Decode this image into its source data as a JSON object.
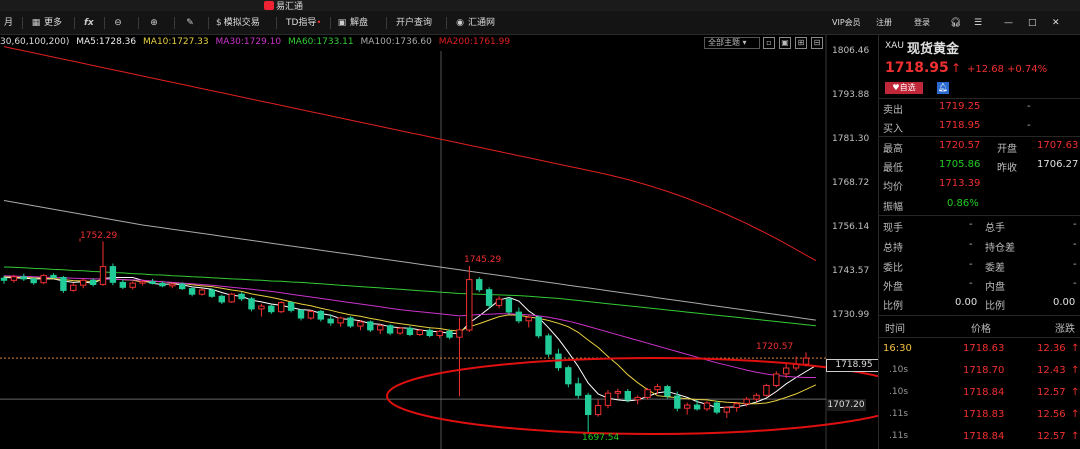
{
  "app": {
    "title": "易汇通"
  },
  "toolbar": {
    "items": [
      {
        "label": "月",
        "icon": ""
      },
      {
        "label": "更多",
        "icon": "grid-icon"
      },
      {
        "label": "",
        "icon": "fx-icon"
      },
      {
        "label": "",
        "icon": "zoom-out-icon"
      },
      {
        "label": "",
        "icon": "zoom-in-icon"
      },
      {
        "label": "",
        "icon": "pen-icon"
      },
      {
        "label": "模拟交易",
        "icon": "dollar-icon"
      },
      {
        "label": "TD指导",
        "icon": "td-icon"
      },
      {
        "label": "解盘",
        "icon": "chat-icon"
      },
      {
        "label": "开户查询",
        "icon": ""
      },
      {
        "label": "汇通网",
        "icon": "globe-icon"
      }
    ],
    "right": {
      "vip": "VIP会员",
      "register": "注册",
      "login": "登录"
    }
  },
  "legend": {
    "params": "30,60,100,200)",
    "ma5": "MA5:1728.36",
    "ma10": "MA10:1727.33",
    "ma30": "MA30:1729.10",
    "ma60": "MA60:1733.11",
    "ma100": "MA100:1736.60",
    "ma200": "MA200:1761.99",
    "theme": "全部主题"
  },
  "colors": {
    "ma5": "#ffffff",
    "ma10": "#e8d040",
    "ma30": "#cc33cc",
    "ma60": "#33cc33",
    "ma100": "#aaaaaa",
    "ma200": "#e02020",
    "up": "#f03030",
    "down": "#22cc99"
  },
  "axis": {
    "ticks": [
      "1806.46",
      "1793.88",
      "1781.30",
      "1768.72",
      "1756.14",
      "1743.57",
      "1730.99",
      "1718.95",
      "1707.20"
    ]
  },
  "annotations": {
    "high1": "1752.29",
    "high2": "1745.29",
    "low": "1697.54",
    "last_high": "1720.57"
  },
  "chart_data": {
    "type": "candlestick",
    "title": "",
    "symbol": "XAU",
    "ylim": [
      1695,
      1810
    ],
    "annotations": {
      "high1": 1752.29,
      "high2": 1745.29,
      "low": 1697.54,
      "recent_high": 1720.57
    },
    "current_price": 1718.95,
    "reference_price": 1707.2,
    "candles": [
      [
        1741.8,
        1742.5,
        1740.2,
        1741.2
      ],
      [
        1741.2,
        1742.8,
        1740.5,
        1742.2
      ],
      [
        1742.2,
        1743.1,
        1741.0,
        1741.6
      ],
      [
        1741.6,
        1742.0,
        1739.9,
        1740.5
      ],
      [
        1740.5,
        1742.9,
        1740.1,
        1742.6
      ],
      [
        1742.6,
        1743.2,
        1741.7,
        1742.0
      ],
      [
        1742.0,
        1742.4,
        1737.6,
        1738.3
      ],
      [
        1738.3,
        1740.4,
        1737.9,
        1739.8
      ],
      [
        1739.8,
        1741.6,
        1738.9,
        1741.2
      ],
      [
        1741.2,
        1741.8,
        1739.4,
        1740.0
      ],
      [
        1740.0,
        1752.3,
        1739.6,
        1745.1
      ],
      [
        1745.1,
        1746.0,
        1739.8,
        1740.6
      ],
      [
        1740.6,
        1741.4,
        1738.7,
        1739.2
      ],
      [
        1739.2,
        1740.9,
        1738.6,
        1740.4
      ],
      [
        1740.4,
        1741.2,
        1739.7,
        1740.8
      ],
      [
        1740.8,
        1741.6,
        1740.0,
        1740.3
      ],
      [
        1740.3,
        1740.8,
        1739.2,
        1739.6
      ],
      [
        1739.6,
        1740.5,
        1738.9,
        1740.1
      ],
      [
        1740.1,
        1740.6,
        1738.4,
        1738.8
      ],
      [
        1738.8,
        1739.3,
        1736.6,
        1737.2
      ],
      [
        1737.2,
        1738.8,
        1736.8,
        1738.4
      ],
      [
        1738.4,
        1738.9,
        1736.1,
        1736.6
      ],
      [
        1736.6,
        1737.1,
        1734.4,
        1735.0
      ],
      [
        1735.0,
        1737.6,
        1734.7,
        1737.2
      ],
      [
        1737.2,
        1737.8,
        1735.3,
        1735.9
      ],
      [
        1735.9,
        1736.4,
        1732.3,
        1733.0
      ],
      [
        1733.0,
        1734.5,
        1730.8,
        1733.8
      ],
      [
        1733.8,
        1734.2,
        1731.6,
        1732.2
      ],
      [
        1732.2,
        1735.2,
        1731.8,
        1734.8
      ],
      [
        1734.8,
        1735.3,
        1732.0,
        1732.6
      ],
      [
        1732.6,
        1733.0,
        1729.7,
        1730.4
      ],
      [
        1730.4,
        1732.8,
        1729.9,
        1732.3
      ],
      [
        1732.3,
        1732.7,
        1729.4,
        1730.1
      ],
      [
        1730.1,
        1731.5,
        1728.2,
        1729.0
      ],
      [
        1729.0,
        1730.8,
        1727.9,
        1730.4
      ],
      [
        1730.4,
        1730.9,
        1727.6,
        1728.1
      ],
      [
        1728.1,
        1729.8,
        1726.9,
        1729.3
      ],
      [
        1729.3,
        1729.7,
        1726.4,
        1727.0
      ],
      [
        1727.0,
        1728.7,
        1725.8,
        1728.2
      ],
      [
        1728.2,
        1728.6,
        1725.5,
        1726.1
      ],
      [
        1726.1,
        1727.9,
        1725.6,
        1727.5
      ],
      [
        1727.5,
        1728.1,
        1725.2,
        1725.7
      ],
      [
        1725.7,
        1727.3,
        1725.3,
        1726.9
      ],
      [
        1726.9,
        1727.4,
        1724.9,
        1725.4
      ],
      [
        1725.4,
        1727.0,
        1724.6,
        1726.6
      ],
      [
        1726.6,
        1727.2,
        1724.3,
        1724.9
      ],
      [
        1724.9,
        1730.5,
        1708.0,
        1727.0
      ],
      [
        1727.0,
        1745.3,
        1726.4,
        1741.4
      ],
      [
        1741.4,
        1742.1,
        1737.8,
        1738.5
      ],
      [
        1738.5,
        1739.2,
        1733.1,
        1734.0
      ],
      [
        1734.0,
        1736.6,
        1733.2,
        1735.8
      ],
      [
        1735.8,
        1736.3,
        1731.4,
        1732.1
      ],
      [
        1732.1,
        1733.4,
        1728.9,
        1729.6
      ],
      [
        1729.6,
        1731.2,
        1727.7,
        1730.6
      ],
      [
        1730.6,
        1731.1,
        1724.6,
        1725.3
      ],
      [
        1725.3,
        1726.0,
        1719.2,
        1720.1
      ],
      [
        1720.1,
        1721.6,
        1715.3,
        1716.2
      ],
      [
        1716.2,
        1716.8,
        1710.6,
        1711.6
      ],
      [
        1711.6,
        1713.4,
        1707.4,
        1708.3
      ],
      [
        1708.3,
        1709.0,
        1697.5,
        1702.8
      ],
      [
        1702.8,
        1707.1,
        1702.2,
        1705.4
      ],
      [
        1705.4,
        1709.8,
        1704.6,
        1708.9
      ],
      [
        1708.9,
        1710.2,
        1707.3,
        1709.4
      ],
      [
        1709.4,
        1710.1,
        1706.3,
        1707.0
      ],
      [
        1707.0,
        1708.3,
        1705.7,
        1707.7
      ],
      [
        1707.7,
        1710.4,
        1707.1,
        1709.9
      ],
      [
        1709.9,
        1711.6,
        1708.7,
        1710.8
      ],
      [
        1710.8,
        1711.3,
        1707.4,
        1708.1
      ],
      [
        1708.1,
        1709.4,
        1703.7,
        1704.6
      ],
      [
        1704.6,
        1706.2,
        1702.8,
        1705.5
      ],
      [
        1705.5,
        1707.0,
        1703.9,
        1704.4
      ],
      [
        1704.4,
        1706.6,
        1703.8,
        1706.1
      ],
      [
        1706.1,
        1706.8,
        1702.9,
        1703.5
      ],
      [
        1703.5,
        1705.2,
        1701.8,
        1704.8
      ],
      [
        1704.8,
        1706.4,
        1703.6,
        1705.9
      ],
      [
        1705.9,
        1707.8,
        1705.1,
        1707.2
      ],
      [
        1707.2,
        1708.9,
        1706.5,
        1708.3
      ],
      [
        1708.3,
        1711.6,
        1707.9,
        1711.1
      ],
      [
        1711.1,
        1715.2,
        1710.6,
        1714.4
      ],
      [
        1714.4,
        1717.3,
        1713.2,
        1716.1
      ],
      [
        1716.1,
        1719.4,
        1715.3,
        1717.2
      ],
      [
        1717.2,
        1720.6,
        1716.5,
        1718.95
      ]
    ],
    "ma_series": [
      {
        "name": "MA5",
        "values": [
          1742.0,
          1741.9,
          1741.8,
          1741.6,
          1741.6,
          1741.6,
          1741.0,
          1740.6,
          1740.8,
          1740.3,
          1741.7,
          1742.0,
          1742.0,
          1742.0,
          1741.2,
          1740.3,
          1740.0,
          1740.2,
          1739.9,
          1739.3,
          1739.0,
          1738.6,
          1737.7,
          1736.9,
          1736.6,
          1735.5,
          1735.0,
          1734.4,
          1734.0,
          1733.4,
          1732.8,
          1732.6,
          1731.7,
          1731.2,
          1730.2,
          1730.0,
          1729.6,
          1728.8,
          1728.6,
          1727.9,
          1727.6,
          1727.5,
          1727.0,
          1726.6,
          1726.5,
          1726.0,
          1726.0,
          1729.0,
          1731.0,
          1733.2,
          1735.5,
          1736.3,
          1735.2,
          1732.4,
          1730.5,
          1727.6,
          1724.4,
          1720.6,
          1716.5,
          1711.8,
          1708.7,
          1707.5,
          1707.0,
          1706.7,
          1707.0,
          1708.0,
          1709.0,
          1709.4,
          1708.6,
          1707.7,
          1706.5,
          1705.7,
          1704.8,
          1704.9,
          1705.0,
          1705.6,
          1706.4,
          1707.5,
          1709.4,
          1711.6,
          1713.4,
          1715.1,
          1716.8
        ]
      },
      {
        "name": "MA10",
        "values": [
          1742.2,
          1742.1,
          1742.0,
          1741.9,
          1741.8,
          1741.7,
          1741.4,
          1741.1,
          1741.0,
          1740.8,
          1741.5,
          1741.6,
          1741.4,
          1741.2,
          1740.7,
          1740.9,
          1740.8,
          1740.5,
          1740.3,
          1739.9,
          1739.6,
          1739.4,
          1738.9,
          1738.4,
          1738.0,
          1737.3,
          1736.8,
          1736.3,
          1735.7,
          1735.0,
          1734.4,
          1733.9,
          1733.2,
          1732.6,
          1731.9,
          1731.3,
          1730.9,
          1730.3,
          1729.8,
          1729.2,
          1728.8,
          1728.4,
          1728.0,
          1727.6,
          1727.4,
          1726.9,
          1726.7,
          1727.9,
          1728.8,
          1729.8,
          1730.8,
          1731.3,
          1731.2,
          1730.7,
          1730.3,
          1729.7,
          1728.9,
          1727.9,
          1726.3,
          1724.1,
          1722.0,
          1719.4,
          1717.0,
          1714.2,
          1711.9,
          1709.9,
          1708.2,
          1707.9,
          1707.6,
          1707.3,
          1707.1,
          1707.0,
          1706.6,
          1706.3,
          1706.2,
          1705.9,
          1705.9,
          1706.1,
          1706.8,
          1707.7,
          1708.7,
          1710.0,
          1711.3
        ]
      },
      {
        "name": "MA30",
        "values": [
          1742.5,
          1742.4,
          1742.3,
          1742.2,
          1742.1,
          1742.0,
          1741.9,
          1741.8,
          1741.7,
          1741.6,
          1741.6,
          1741.5,
          1741.4,
          1741.3,
          1741.2,
          1741.0,
          1740.8,
          1740.6,
          1740.4,
          1740.2,
          1740.0,
          1739.8,
          1739.5,
          1739.2,
          1738.9,
          1738.6,
          1738.3,
          1738.0,
          1737.6,
          1737.2,
          1736.8,
          1736.4,
          1736.0,
          1735.6,
          1735.2,
          1734.8,
          1734.4,
          1734.0,
          1733.6,
          1733.2,
          1732.8,
          1732.5,
          1732.2,
          1731.9,
          1731.6,
          1731.3,
          1731.0,
          1731.2,
          1731.4,
          1731.5,
          1731.6,
          1731.6,
          1731.5,
          1731.3,
          1731.0,
          1730.6,
          1730.1,
          1729.5,
          1728.8,
          1728.0,
          1727.2,
          1726.4,
          1725.6,
          1724.8,
          1724.0,
          1723.2,
          1722.4,
          1721.6,
          1720.8,
          1720.0,
          1719.2,
          1718.4,
          1717.6,
          1716.9,
          1716.2,
          1715.5,
          1714.9,
          1714.4,
          1714.0,
          1713.7,
          1713.5,
          1713.4,
          1713.4
        ]
      },
      {
        "name": "MA60",
        "values": [
          1745.0,
          1744.9,
          1744.8,
          1744.6,
          1744.5,
          1744.3,
          1744.2,
          1744.0,
          1743.9,
          1743.7,
          1743.6,
          1743.4,
          1743.3,
          1743.1,
          1743.0,
          1742.8,
          1742.7,
          1742.5,
          1742.4,
          1742.2,
          1742.1,
          1741.9,
          1741.8,
          1741.6,
          1741.5,
          1741.3,
          1741.2,
          1741.0,
          1740.9,
          1740.7,
          1740.6,
          1740.4,
          1740.2,
          1740.0,
          1739.8,
          1739.6,
          1739.4,
          1739.2,
          1739.0,
          1738.8,
          1738.6,
          1738.4,
          1738.2,
          1738.0,
          1737.8,
          1737.6,
          1737.4,
          1737.3,
          1737.2,
          1737.1,
          1737.0,
          1736.9,
          1736.8,
          1736.6,
          1736.4,
          1736.2,
          1736.0,
          1735.7,
          1735.4,
          1735.1,
          1734.8,
          1734.5,
          1734.2,
          1733.9,
          1733.6,
          1733.3,
          1733.0,
          1732.7,
          1732.4,
          1732.1,
          1731.8,
          1731.5,
          1731.2,
          1730.9,
          1730.6,
          1730.3,
          1730.0,
          1729.7,
          1729.4,
          1729.1,
          1728.8,
          1728.5,
          1728.2
        ]
      },
      {
        "name": "MA100",
        "values": [
          1764.0,
          1763.5,
          1763.0,
          1762.5,
          1762.0,
          1761.5,
          1761.0,
          1760.5,
          1760.0,
          1759.5,
          1759.0,
          1758.5,
          1758.0,
          1757.5,
          1757.0,
          1756.6,
          1756.2,
          1755.8,
          1755.4,
          1755.0,
          1754.6,
          1754.2,
          1753.8,
          1753.4,
          1753.0,
          1752.6,
          1752.2,
          1751.8,
          1751.4,
          1751.0,
          1750.6,
          1750.2,
          1749.8,
          1749.4,
          1749.0,
          1748.6,
          1748.2,
          1747.8,
          1747.4,
          1747.0,
          1746.6,
          1746.2,
          1745.8,
          1745.4,
          1745.0,
          1744.6,
          1744.2,
          1743.8,
          1743.4,
          1743.0,
          1742.6,
          1742.2,
          1741.8,
          1741.4,
          1741.0,
          1740.6,
          1740.2,
          1739.8,
          1739.4,
          1739.0,
          1738.6,
          1738.2,
          1737.8,
          1737.4,
          1737.0,
          1736.6,
          1736.2,
          1735.8,
          1735.4,
          1735.0,
          1734.6,
          1734.2,
          1733.8,
          1733.4,
          1733.0,
          1732.6,
          1732.2,
          1731.8,
          1731.4,
          1731.0,
          1730.6,
          1730.2,
          1729.8
        ]
      },
      {
        "name": "MA200",
        "values": [
          1808.0,
          1807.4,
          1806.8,
          1806.2,
          1805.6,
          1805.0,
          1804.4,
          1803.8,
          1803.2,
          1802.6,
          1802.0,
          1801.4,
          1800.8,
          1800.2,
          1799.6,
          1799.0,
          1798.4,
          1797.8,
          1797.2,
          1796.6,
          1796.0,
          1795.4,
          1794.8,
          1794.2,
          1793.6,
          1793.0,
          1792.4,
          1791.8,
          1791.2,
          1790.6,
          1790.0,
          1789.4,
          1788.8,
          1788.2,
          1787.6,
          1787.0,
          1786.4,
          1785.8,
          1785.2,
          1784.6,
          1784.0,
          1783.4,
          1782.8,
          1782.2,
          1781.6,
          1781.0,
          1780.4,
          1779.8,
          1779.2,
          1778.6,
          1778.0,
          1777.4,
          1776.8,
          1776.2,
          1775.6,
          1775.0,
          1774.4,
          1773.8,
          1773.2,
          1772.6,
          1772.0,
          1771.4,
          1770.7,
          1770.0,
          1769.2,
          1768.4,
          1767.5,
          1766.6,
          1765.6,
          1764.6,
          1763.5,
          1762.4,
          1761.2,
          1760.0,
          1758.7,
          1757.4,
          1756.0,
          1754.6,
          1753.1,
          1751.6,
          1750.0,
          1748.4,
          1746.8
        ]
      }
    ]
  },
  "quote": {
    "symbol": "XAU",
    "name": "现货黄金",
    "price": "1718.95",
    "arrow": "↑",
    "change": "+12.68",
    "change_pct": "+0.74%",
    "btn_self": "自选",
    "rows": [
      {
        "label": "卖出",
        "value": "1719.25",
        "label2": "",
        "value2": "-"
      },
      {
        "label": "买入",
        "value": "1718.95",
        "label2": "",
        "value2": "-"
      },
      {
        "label": "最高",
        "value": "1720.57",
        "label2": "开盘",
        "value2": "1707.63"
      },
      {
        "label": "最低",
        "value": "1705.86",
        "label2": "昨收",
        "value2": "1706.27"
      },
      {
        "label": "均价",
        "value": "1713.39",
        "label2": "",
        "value2": ""
      },
      {
        "label": "振幅",
        "value": "0.86%",
        "label2": "",
        "value2": ""
      },
      {
        "label": "现手",
        "value": "-",
        "label2": "总手",
        "value2": "-"
      },
      {
        "label": "总持",
        "value": "-",
        "label2": "持仓差",
        "value2": "-"
      },
      {
        "label": "委比",
        "value": "-",
        "label2": "委差",
        "value2": "-"
      },
      {
        "label": "外盘",
        "value": "-",
        "label2": "内盘",
        "value2": "-"
      },
      {
        "label": "比例",
        "value": "0.00",
        "label2": "比例",
        "value2": "0.00"
      }
    ],
    "ticks_header": {
      "time": "时间",
      "price": "价格",
      "change": "涨跌"
    },
    "ticks": [
      {
        "time": "16:30",
        "price": "1718.63",
        "change": "12.36"
      },
      {
        "time": ".10s",
        "price": "1718.70",
        "change": "12.43"
      },
      {
        "time": ".10s",
        "price": "1718.84",
        "change": "12.57"
      },
      {
        "time": ".11s",
        "price": "1718.83",
        "change": "12.56"
      },
      {
        "time": ".11s",
        "price": "1718.84",
        "change": "12.57"
      }
    ]
  }
}
